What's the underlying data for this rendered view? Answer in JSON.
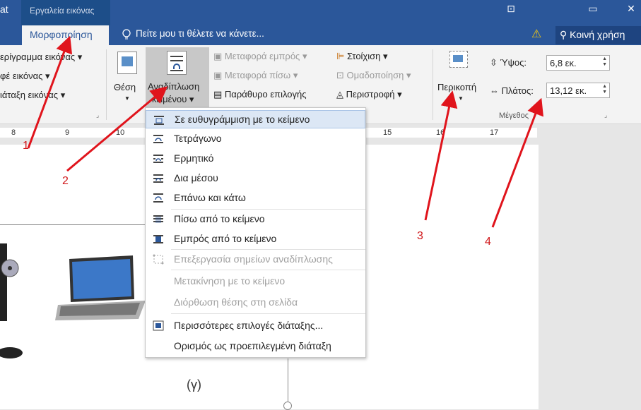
{
  "window": {
    "context_tab": "Εργαλεία εικόνας",
    "controls": [
      "⊡",
      "▭",
      "✕"
    ]
  },
  "tabs": {
    "left_partial": "at",
    "active": "Μορφοποίηση",
    "tell_me": "Πείτε μου τι θέλετε να κάνετε...",
    "share": "Κοινή χρήση"
  },
  "ribbon": {
    "left_items": [
      "ερίγραμμα εικόνας",
      "φέ εικόνας",
      "ιάταξη εικόνας"
    ],
    "position_label": "Θέση",
    "wrap_label_1": "Αναδίπλωση",
    "wrap_label_2": "κειμένου",
    "bring_forward": "Μεταφορά εμπρός",
    "send_backward": "Μεταφορά πίσω",
    "selection_pane": "Παράθυρο επιλογής",
    "align": "Στοίχιση",
    "group": "Ομαδοποίηση",
    "rotate": "Περιστροφή",
    "crop": "Περικοπή",
    "height_label": "Ύψος:",
    "height_value": "6,8 εκ.",
    "width_label": "Πλάτος:",
    "width_value": "13,12 εκ.",
    "size_group": "Μέγεθος"
  },
  "ruler": [
    "8",
    "9",
    "10",
    "15",
    "16",
    "17"
  ],
  "menu": {
    "items": [
      "Σε ευθυγράμμιση με το κείμενο",
      "Τετράγωνο",
      "Ερμητικό",
      "Δια μέσου",
      "Επάνω και κάτω",
      "Πίσω από το κείμενο",
      "Εμπρός από το κείμενο",
      "Επεξεργασία σημείων αναδίπλωσης",
      "Μετακίνηση με το κείμενο",
      "Διόρθωση θέσης στη σελίδα",
      "Περισσότερες επιλογές διάταξης...",
      "Ορισμός ως προεπιλεγμένη διάταξη"
    ]
  },
  "document": {
    "caption": "(γ)"
  },
  "annotations": [
    "1",
    "2",
    "3",
    "4"
  ],
  "colors": {
    "accent": "#2b579a",
    "arrow": "#e0141c"
  }
}
